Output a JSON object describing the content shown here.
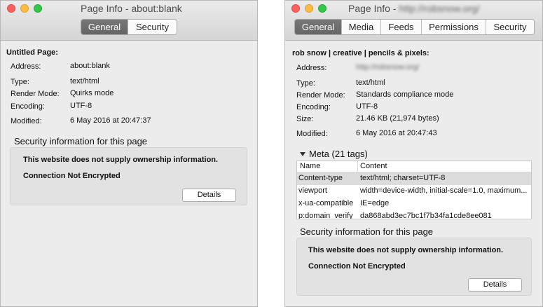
{
  "window1": {
    "title": "Page Info - about:blank",
    "tabs": [
      {
        "label": "General",
        "active": true
      },
      {
        "label": "Security",
        "active": false
      }
    ],
    "page_title": "Untitled Page:",
    "fields": {
      "address_label": "Address:",
      "address": "about:blank",
      "type_label": "Type:",
      "type": "text/html",
      "render_label": "Render Mode:",
      "render": "Quirks mode",
      "encoding_label": "Encoding:",
      "encoding": "UTF-8",
      "modified_label": "Modified:",
      "modified": "6 May 2016 at 20:47:37"
    },
    "security": {
      "heading": "Security information for this page",
      "ownership": "This website does not supply ownership information.",
      "connection": "Connection Not Encrypted",
      "details_button": "Details"
    }
  },
  "window2": {
    "title_prefix": "Page Info -",
    "title_url": "http://robsnow.org/",
    "tabs": [
      {
        "label": "General",
        "active": true
      },
      {
        "label": "Media",
        "active": false
      },
      {
        "label": "Feeds",
        "active": false
      },
      {
        "label": "Permissions",
        "active": false
      },
      {
        "label": "Security",
        "active": false
      }
    ],
    "page_title": "rob snow | creative | pencils & pixels:",
    "fields": {
      "address_label": "Address:",
      "address": "http://robsnow.org/",
      "type_label": "Type:",
      "type": "text/html",
      "render_label": "Render Mode:",
      "render": "Standards compliance mode",
      "encoding_label": "Encoding:",
      "encoding": "UTF-8",
      "size_label": "Size:",
      "size": "21.46 KB (21,974 bytes)",
      "modified_label": "Modified:",
      "modified": "6 May 2016 at 20:47:43"
    },
    "meta": {
      "heading": "Meta (21 tags)",
      "columns": [
        "Name",
        "Content"
      ],
      "rows": [
        {
          "name": "Content-type",
          "content": "text/html; charset=UTF-8"
        },
        {
          "name": "viewport",
          "content": "width=device-width, initial-scale=1.0, maximum..."
        },
        {
          "name": "x-ua-compatible",
          "content": "IE=edge"
        },
        {
          "name": "p:domain_verify",
          "content": "da868abd3ec7bc1f7b34fa1cde8ee081"
        }
      ]
    },
    "security": {
      "heading": "Security information for this page",
      "ownership": "This website does not supply ownership information.",
      "connection": "Connection Not Encrypted",
      "details_button": "Details"
    }
  },
  "colors": {
    "accent_tab": "#6e6e6e",
    "window_bg": "#ececec",
    "section_bg": "#e2e2e2",
    "selected_row": "#dcdcdc"
  }
}
